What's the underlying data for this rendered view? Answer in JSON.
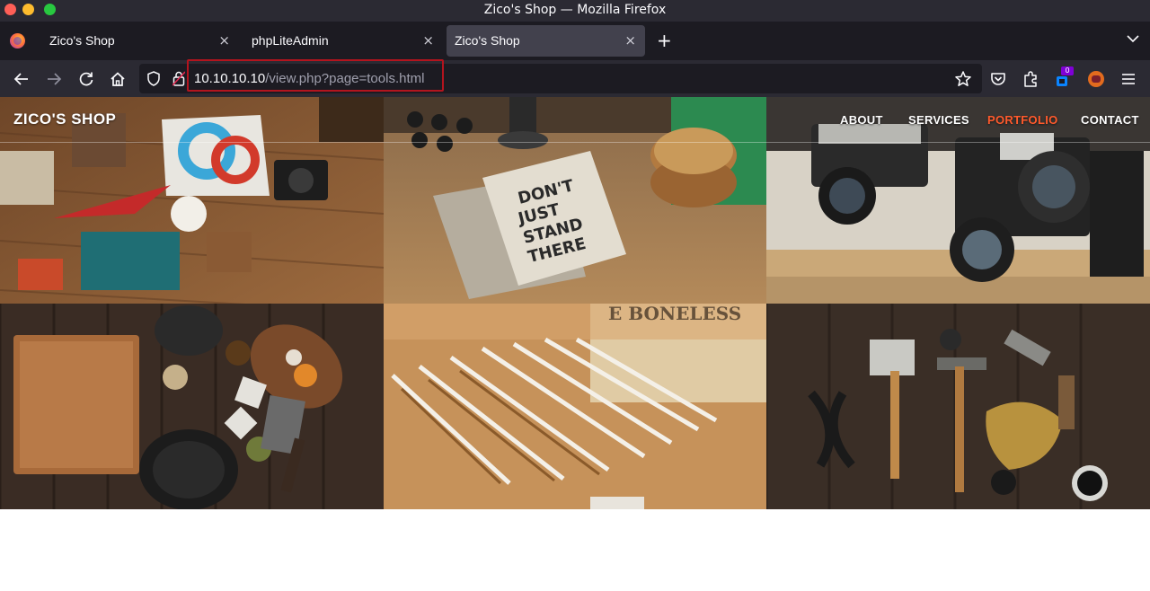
{
  "window": {
    "title": "Zico's Shop — Mozilla Firefox"
  },
  "tabs": [
    {
      "label": "Zico's Shop",
      "active": false
    },
    {
      "label": "phpLiteAdmin",
      "active": false
    },
    {
      "label": "Zico's Shop",
      "active": true
    }
  ],
  "tab_close_glyph": "×",
  "new_tab_glyph": "+",
  "address_bar": {
    "host": "10.10.10.10",
    "path": "/view.php?page=tools.html"
  },
  "toolbar": {
    "extension_badge": "0"
  },
  "site": {
    "brand": "ZICO'S SHOP",
    "nav": [
      {
        "label": "ABOUT",
        "active": false
      },
      {
        "label": "SERVICES",
        "active": false
      },
      {
        "label": "PORTFOLIO",
        "active": true
      },
      {
        "label": "CONTACT",
        "active": false
      }
    ],
    "accent_color": "#ff5a2c"
  },
  "portfolio_photos": [
    "desk-flatlay-photo",
    "notebook-photo",
    "vintage-cameras-photo",
    "kitchen-herbs-photo",
    "pencils-photo",
    "old-tools-photo"
  ],
  "icons": [
    "back-icon",
    "forward-icon",
    "reload-icon",
    "home-icon",
    "shield-icon",
    "lock-icon",
    "bookmark-star-icon",
    "pocket-icon",
    "extensions-icon",
    "menu-icon"
  ]
}
